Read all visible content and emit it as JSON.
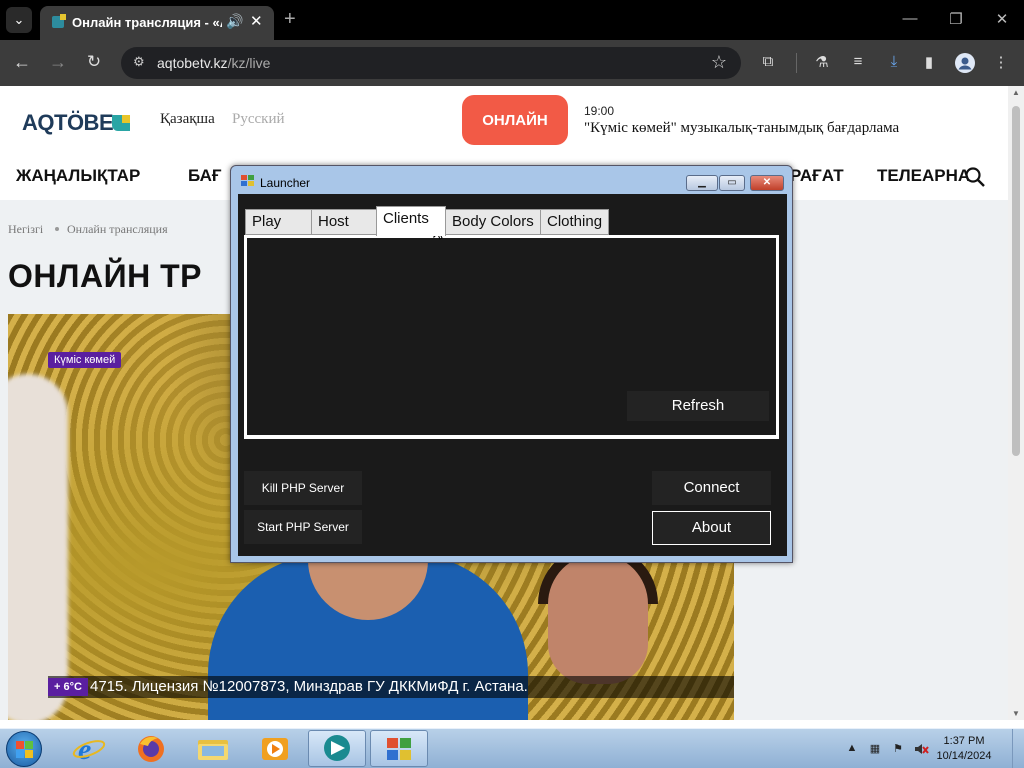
{
  "browser": {
    "tab_title": "Онлайн трансляция - «AQ",
    "url_domain": "aqtobetv.kz",
    "url_path": "/kz/live",
    "window_controls": {
      "minimize": "—",
      "restore": "❐",
      "close": "✕"
    }
  },
  "site": {
    "logo_text": "AQTÖBE",
    "languages": [
      "Қазақша",
      "Русский"
    ],
    "online_button": "ОНЛАЙН",
    "schedule": {
      "time": "19:00",
      "title": "\"Күміс көмей\" музыкалық-танымдық бағдарлама"
    },
    "menu": [
      "ЖАҢАЛЫҚТАР",
      "БАҒ",
      "РАҒАТ",
      "ТЕЛЕАРНА"
    ],
    "breadcrumb": [
      "Негізгі",
      "Онлайн трансляция"
    ],
    "heading": "ОНЛАЙН ТР",
    "video": {
      "show_badge": "Күміс көмей",
      "temperature": "+ 6°C",
      "ticker": "4715. Лицензия №12007873, Минздрав ГУ ДККМиФД г. Астана."
    }
  },
  "launcher": {
    "title": "Launcher",
    "tabs": [
      "Play",
      "Host",
      "Clients",
      "Body Colors",
      "Clothing"
    ],
    "active_tab": "Clients",
    "refresh_label": "Refresh",
    "kill_label": "Kill PHP Server",
    "start_label": "Start PHP Server",
    "connect_label": "Connect",
    "about_label": "About"
  },
  "taskbar": {
    "time": "1:37 PM",
    "date": "10/14/2024",
    "apps": [
      "internet-explorer",
      "firefox",
      "file-explorer",
      "media-player",
      "launcher-app",
      "windows-app"
    ]
  },
  "colors": {
    "accent_online": "#f25a46",
    "launcher_bg": "#1a1a1a",
    "show_badge": "#5a1fa0"
  }
}
